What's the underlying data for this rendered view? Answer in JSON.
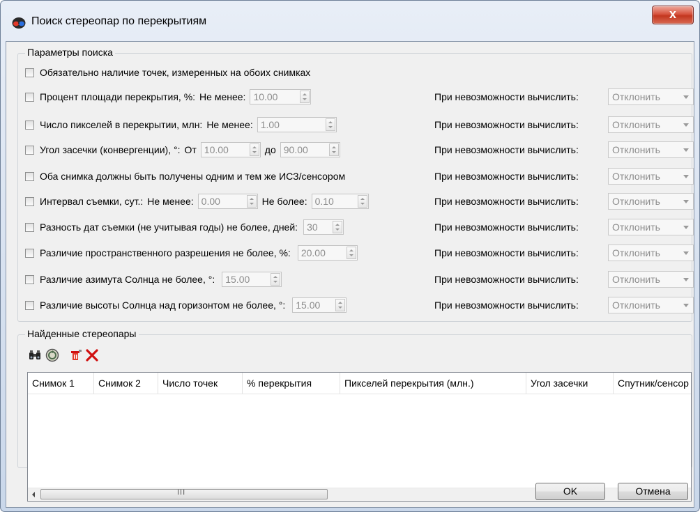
{
  "window": {
    "title": "Поиск стереопар по перекрытиям",
    "close_label": "x",
    "icon": "stereo-glasses-icon"
  },
  "search_params": {
    "group_title": "Параметры поиска",
    "fail_label": "При невозможности вычислить:",
    "fail_option": "Отклонить",
    "rows": [
      {
        "label": "Обязательно наличие точек, измеренных на обоих снимках"
      },
      {
        "label": "Процент площади перекрытия, %:",
        "min_label": "Не менее:",
        "min_value": "10.00"
      },
      {
        "label": "Число пикселей в перекрытии, млн:",
        "min_label": "Не менее:",
        "min_value": "1.00"
      },
      {
        "label": "Угол засечки (конвергенции), °:",
        "from_label": "От",
        "from_value": "10.00",
        "to_label": "до",
        "to_value": "90.00"
      },
      {
        "label": "Оба снимка должны быть получены одним и тем же ИСЗ/сенсором"
      },
      {
        "label": "Интервал съемки, сут.:",
        "min_label": "Не менее:",
        "min_value": "0.00",
        "max_label": "Не более:",
        "max_value": "0.10"
      },
      {
        "label": "Разность дат съемки (не учитывая годы) не более, дней:",
        "value": "30"
      },
      {
        "label": "Различие пространственного разрешения не более, %:",
        "value": "20.00"
      },
      {
        "label": "Различие азимута Солнца не более, °:",
        "value": "15.00"
      },
      {
        "label": "Различие высоты Солнца над горизонтом не более, °:",
        "value": "15.00"
      }
    ]
  },
  "results": {
    "group_title": "Найденные стереопары",
    "toolbar": [
      "binoculars-icon",
      "refresh-icon",
      "clear-icon",
      "delete-icon"
    ],
    "columns": [
      "Снимок 1",
      "Снимок 2",
      "Число точек",
      "% перекрытия",
      "Пикселей перекрытия (млн.)",
      "Угол засечки",
      "Спутник/сенсор"
    ],
    "scroll_grip": "III"
  },
  "buttons": {
    "ok": "OK",
    "cancel": "Отмена"
  },
  "colors": {
    "close_button": "#c9432c",
    "delete_icon": "#d01010"
  }
}
